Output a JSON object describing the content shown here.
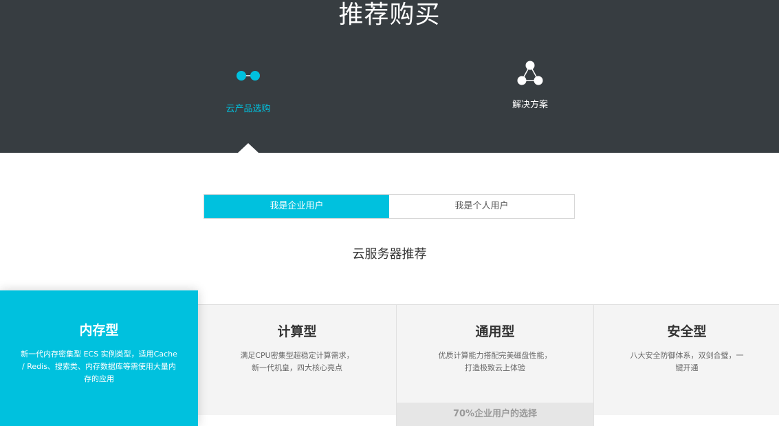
{
  "hero": {
    "title": "推荐购买",
    "nav": [
      {
        "label": "云产品选购",
        "icon": "connected-nodes-icon",
        "active": true
      },
      {
        "label": "解决方案",
        "icon": "triangle-nodes-icon",
        "active": false
      }
    ]
  },
  "toggle": {
    "tabs": [
      {
        "label": "我是企业用户",
        "active": true
      },
      {
        "label": "我是个人用户",
        "active": false
      }
    ]
  },
  "section": {
    "title": "云服务器推荐"
  },
  "cards": [
    {
      "title": "内存型",
      "description": "新一代内存密集型 ECS 实例类型，适用Cache / Redis、搜索类、内存数据库等需使用大量内存的应用",
      "active": true
    },
    {
      "title": "计算型",
      "description": "满足CPU密集型超稳定计算需求，新一代机皇，四大核心亮点",
      "active": false
    },
    {
      "title": "通用型",
      "description": "优质计算能力搭配完美磁盘性能，打造极致云上体验",
      "badge": "70%企业用户的选择",
      "active": false
    },
    {
      "title": "安全型",
      "description": "八大安全防御体系，双剑合璧，一键开通",
      "active": false
    }
  ],
  "colors": {
    "accent": "#00c1de",
    "hero_bg": "#373d41"
  }
}
